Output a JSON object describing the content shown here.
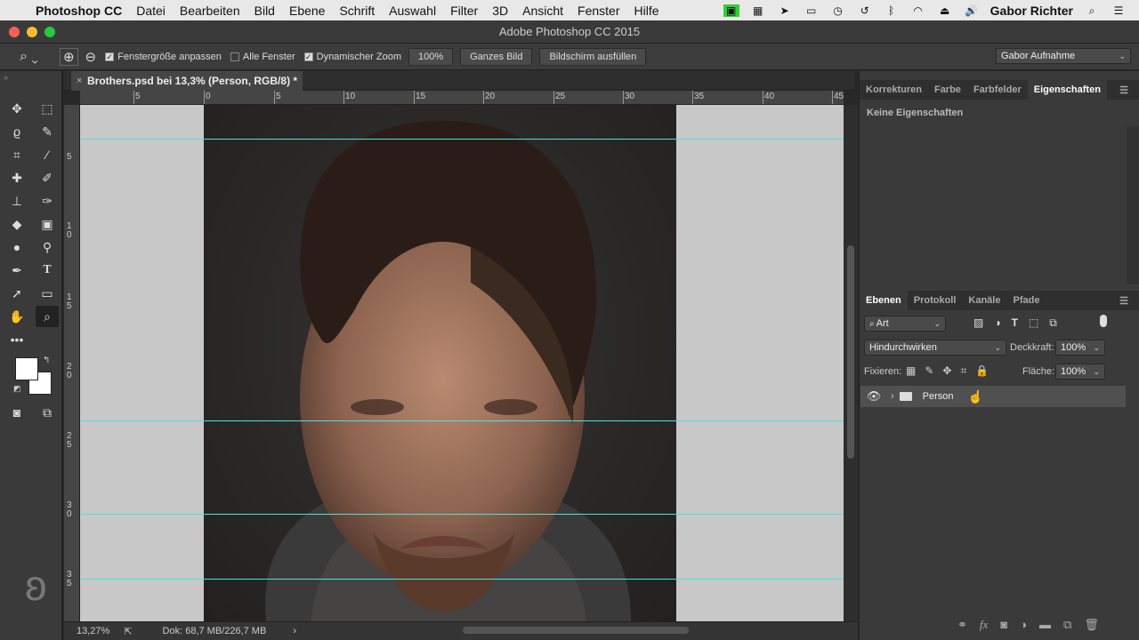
{
  "menubar": {
    "app_name": "Photoshop CC",
    "items": [
      "Datei",
      "Bearbeiten",
      "Bild",
      "Ebene",
      "Schrift",
      "Auswahl",
      "Filter",
      "3D",
      "Ansicht",
      "Fenster",
      "Hilfe"
    ],
    "user": "Gabor Richter"
  },
  "window": {
    "title": "Adobe Photoshop CC 2015"
  },
  "options": {
    "fit_window": "Fenstergröße anpassen",
    "all_windows": "Alle Fenster",
    "dynamic_zoom": "Dynamischer Zoom",
    "zoom_value": "100%",
    "whole_image": "Ganzes Bild",
    "fill_screen": "Bildschirm ausfüllen",
    "workspace": "Gabor Aufnahme",
    "fit_window_checked": true,
    "all_windows_checked": false,
    "dynamic_zoom_checked": true
  },
  "document": {
    "tab_title": "Brothers.psd bei 13,3% (Person, RGB/8) *"
  },
  "rulers": {
    "h_labels": [
      "5",
      "0",
      "5",
      "10",
      "15",
      "20",
      "25",
      "30",
      "35",
      "40",
      "45"
    ],
    "v_labels": [
      "5",
      "1\n0",
      "1\n5",
      "2\n0",
      "2\n5",
      "3\n0",
      "3\n5"
    ]
  },
  "status": {
    "zoom": "13,27%",
    "doc": "Dok: 68,7 MB/226,7 MB"
  },
  "properties_panel": {
    "tabs": [
      "Korrekturen",
      "Farbe",
      "Farbfelder",
      "Eigenschaften"
    ],
    "active_tab": "Eigenschaften",
    "empty_text": "Keine Eigenschaften"
  },
  "layers_panel": {
    "tabs": [
      "Ebenen",
      "Protokoll",
      "Kanäle",
      "Pfade"
    ],
    "active_tab": "Ebenen",
    "filter_kind": "Art",
    "blend_mode": "Hindurchwirken",
    "opacity_label": "Deckkraft:",
    "opacity_value": "100%",
    "lock_label": "Fixieren:",
    "fill_label": "Fläche:",
    "fill_value": "100%",
    "layers": [
      {
        "name": "Person",
        "type": "group",
        "visible": true
      }
    ]
  },
  "colors": {
    "foreground": "#ffffff",
    "background": "#ffffff",
    "guide": "#4ee0e0"
  }
}
